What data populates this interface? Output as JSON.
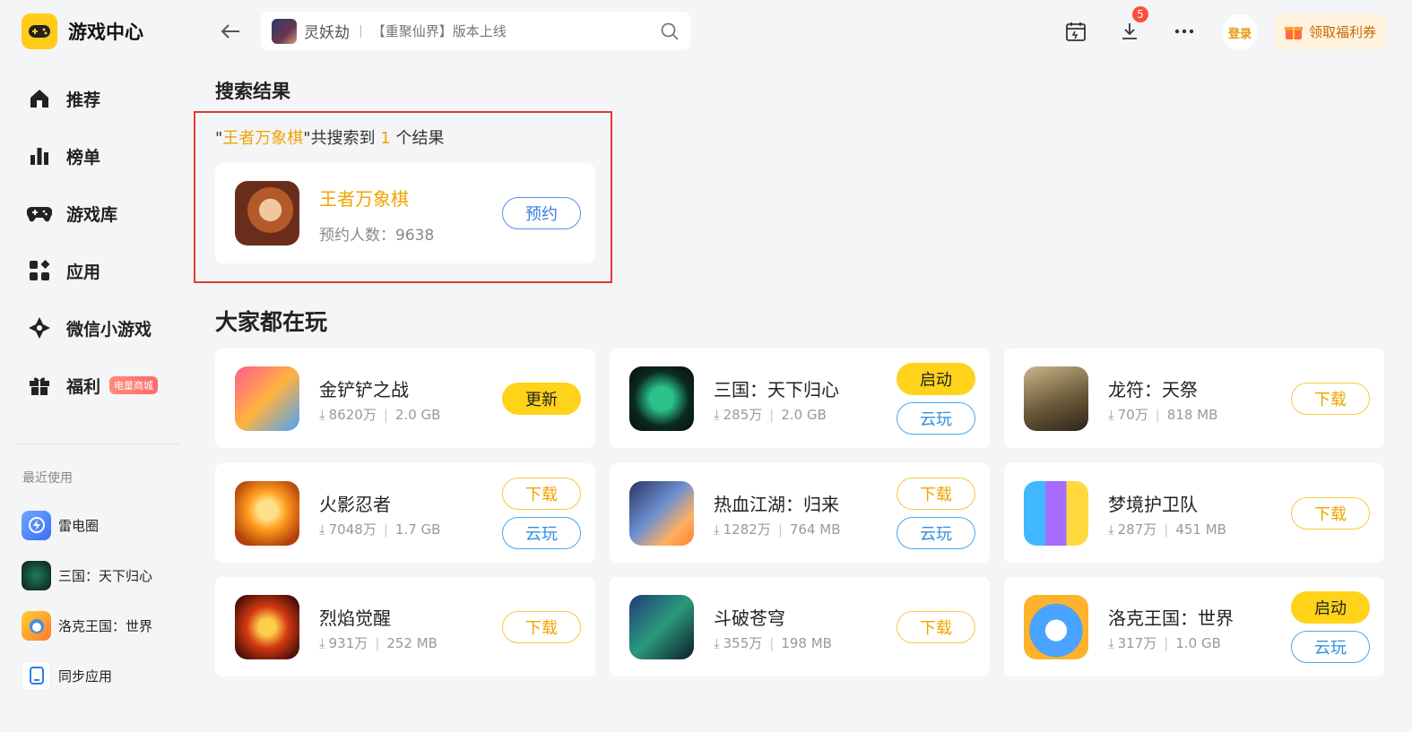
{
  "app": {
    "title": "游戏中心"
  },
  "sidebar": {
    "items": [
      {
        "label": "推荐",
        "icon": "home-icon"
      },
      {
        "label": "榜单",
        "icon": "ranking-icon"
      },
      {
        "label": "游戏库",
        "icon": "gamepad-icon"
      },
      {
        "label": "应用",
        "icon": "apps-icon"
      },
      {
        "label": "微信小游戏",
        "icon": "wechat-minigame-icon"
      },
      {
        "label": "福利",
        "icon": "gift-icon",
        "badge": "电量商城"
      }
    ],
    "recent_title": "最近使用",
    "recent": [
      {
        "label": "雷电圈",
        "icon": "leidian-circle-icon"
      },
      {
        "label": "三国：天下归心",
        "icon": "sanguo-app-icon"
      },
      {
        "label": "洛克王国：世界",
        "icon": "roco-app-icon"
      },
      {
        "label": "同步应用",
        "icon": "sync-app-icon"
      }
    ]
  },
  "header": {
    "search_game": "灵妖劫",
    "search_sep": "|",
    "search_placeholder": "【重聚仙界】版本上线",
    "download_count": "5",
    "login_label": "登录",
    "coupon_label": "领取福利券"
  },
  "results": {
    "title": "搜索结果",
    "quote_open": "\"",
    "query": "王者万象棋",
    "quote_close": "\"",
    "found_prefix": "共搜索到",
    "count": "1",
    "found_suffix": "个结果",
    "item": {
      "name": "王者万象棋",
      "sub": "预约人数：9638",
      "action": "预约"
    }
  },
  "popular": {
    "title": "大家都在玩",
    "games": [
      {
        "name": "金铲铲之战",
        "downloads": "8620万",
        "size": "2.0 GB",
        "primary": "更新",
        "primary_style": "yellow",
        "secondary": ""
      },
      {
        "name": "三国：天下归心",
        "downloads": "285万",
        "size": "2.0 GB",
        "primary": "启动",
        "primary_style": "yellow",
        "secondary": "云玩"
      },
      {
        "name": "龙符：天祭",
        "downloads": "70万",
        "size": "818 MB",
        "primary": "下载",
        "primary_style": "download",
        "secondary": ""
      },
      {
        "name": "火影忍者",
        "downloads": "7048万",
        "size": "1.7 GB",
        "primary": "下载",
        "primary_style": "download",
        "secondary": "云玩"
      },
      {
        "name": "热血江湖：归来",
        "downloads": "1282万",
        "size": "764 MB",
        "primary": "下载",
        "primary_style": "download",
        "secondary": "云玩"
      },
      {
        "name": "梦境护卫队",
        "downloads": "287万",
        "size": "451 MB",
        "primary": "下载",
        "primary_style": "download",
        "secondary": ""
      },
      {
        "name": "烈焰觉醒",
        "downloads": "931万",
        "size": "252 MB",
        "primary": "下载",
        "primary_style": "download",
        "secondary": ""
      },
      {
        "name": "斗破苍穹",
        "downloads": "355万",
        "size": "198 MB",
        "primary": "下载",
        "primary_style": "download",
        "secondary": ""
      },
      {
        "name": "洛克王国：世界",
        "downloads": "317万",
        "size": "1.0 GB",
        "primary": "启动",
        "primary_style": "yellow",
        "secondary": "云玩"
      }
    ]
  },
  "colors": {
    "accent_yellow": "#ffd319",
    "highlight_orange": "#f0a400",
    "cloud_blue": "#2f8ee0",
    "annotation_red": "#e53935"
  }
}
